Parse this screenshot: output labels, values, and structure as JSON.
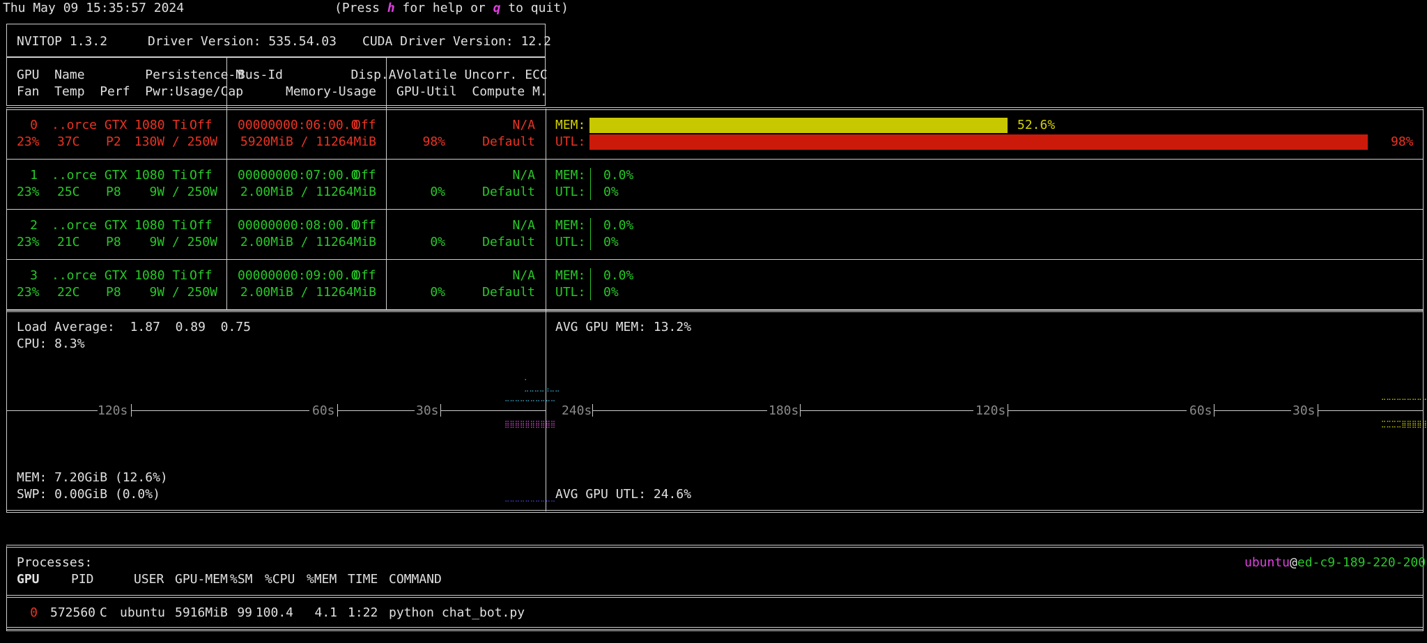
{
  "header": {
    "datetime": "Thu May 09 15:35:57 2024",
    "help_prefix": "(Press ",
    "help_key": "h",
    "help_middle": " for help or ",
    "quit_key": "q",
    "help_suffix": " to quit)"
  },
  "info": {
    "nvitop": "NVITOP 1.3.2",
    "driver": "Driver Version: 535.54.03",
    "cuda": "CUDA Driver Version: 12.2"
  },
  "columns": {
    "row1_a": "GPU  Name        Persistence-M",
    "row2_a": "Fan  Temp  Perf  Pwr:Usage/Cap",
    "row1_b": "Bus-Id         Disp.A",
    "row2_b": "Memory-Usage",
    "row1_c": "Volatile Uncorr. ECC",
    "row2_c": "GPU-Util  Compute M."
  },
  "gpus": [
    {
      "index": "0",
      "name": "..orce GTX 1080 Ti",
      "persistence": "Off",
      "fan": "23%",
      "temp": "37C",
      "perf": "P2",
      "power": "130W / 250W",
      "bus_id": "00000000:06:00.0",
      "disp": "Off",
      "memory": "5920MiB / 11264MiB",
      "ecc": "N/A",
      "util": "98%",
      "compute": "Default",
      "mem_label": "MEM:",
      "mem_pct": "52.6%",
      "mem_frac": 0.526,
      "utl_label": "UTL:",
      "utl_pct": "98%",
      "utl_frac": 0.98
    },
    {
      "index": "1",
      "name": "..orce GTX 1080 Ti",
      "persistence": "Off",
      "fan": "23%",
      "temp": "25C",
      "perf": "P8",
      "power": "9W / 250W",
      "bus_id": "00000000:07:00.0",
      "disp": "Off",
      "memory": "2.00MiB / 11264MiB",
      "ecc": "N/A",
      "util": "0%",
      "compute": "Default",
      "mem_label": "MEM:",
      "mem_pct": "0.0%",
      "mem_frac": 0.0,
      "utl_label": "UTL:",
      "utl_pct": "0%",
      "utl_frac": 0.0
    },
    {
      "index": "2",
      "name": "..orce GTX 1080 Ti",
      "persistence": "Off",
      "fan": "23%",
      "temp": "21C",
      "perf": "P8",
      "power": "9W / 250W",
      "bus_id": "00000000:08:00.0",
      "disp": "Off",
      "memory": "2.00MiB / 11264MiB",
      "ecc": "N/A",
      "util": "0%",
      "compute": "Default",
      "mem_label": "MEM:",
      "mem_pct": "0.0%",
      "mem_frac": 0.0,
      "utl_label": "UTL:",
      "utl_pct": "0%",
      "utl_frac": 0.0
    },
    {
      "index": "3",
      "name": "..orce GTX 1080 Ti",
      "persistence": "Off",
      "fan": "23%",
      "temp": "22C",
      "perf": "P8",
      "power": "9W / 250W",
      "bus_id": "00000000:09:00.0",
      "disp": "Off",
      "memory": "2.00MiB / 11264MiB",
      "ecc": "N/A",
      "util": "0%",
      "compute": "Default",
      "mem_label": "MEM:",
      "mem_pct": "0.0%",
      "mem_frac": 0.0,
      "utl_label": "UTL:",
      "utl_pct": "0%",
      "utl_frac": 0.0
    }
  ],
  "host": {
    "load_label": "Load Average:",
    "load_values": "1.87  0.89  0.75",
    "cpu": "CPU: 8.3%",
    "mem": "MEM: 7.20GiB (12.6%)",
    "swp": "SWP: 0.00GiB (0.0%)",
    "left_ticks": [
      "120s",
      "60s",
      "30s"
    ],
    "avg_gpu_mem": "AVG GPU MEM: 13.2%",
    "avg_gpu_utl": "AVG GPU UTL: 24.6%",
    "right_ticks": [
      "240s",
      "180s",
      "120s",
      "60s",
      "30s"
    ]
  },
  "processes": {
    "title": "Processes:",
    "user": "ubuntu",
    "at": "@",
    "hostname": "ed-c9-189-220-200",
    "headers": [
      "GPU",
      "PID",
      "USER",
      "GPU-MEM",
      "%SM",
      "%CPU",
      "%MEM",
      "TIME",
      "COMMAND"
    ],
    "rows": [
      {
        "gpu": "0",
        "pid": "572560",
        "type": "C",
        "user": "ubuntu",
        "gpu_mem": "5916MiB",
        "sm": "99",
        "cpu": "100.4",
        "mem": "4.1",
        "time": "1:22",
        "command": "python chat_bot.py"
      }
    ]
  },
  "colors": {
    "busy_gpu": "#ea3323",
    "idle_gpu": "#28c828",
    "mem_bar": "#c8c800",
    "utl_bar": "#cc1a0a",
    "cpu_graph": "#3aa8c8",
    "mem_graph": "#d040d0",
    "gpu_mem_graph": "#c8c800"
  }
}
